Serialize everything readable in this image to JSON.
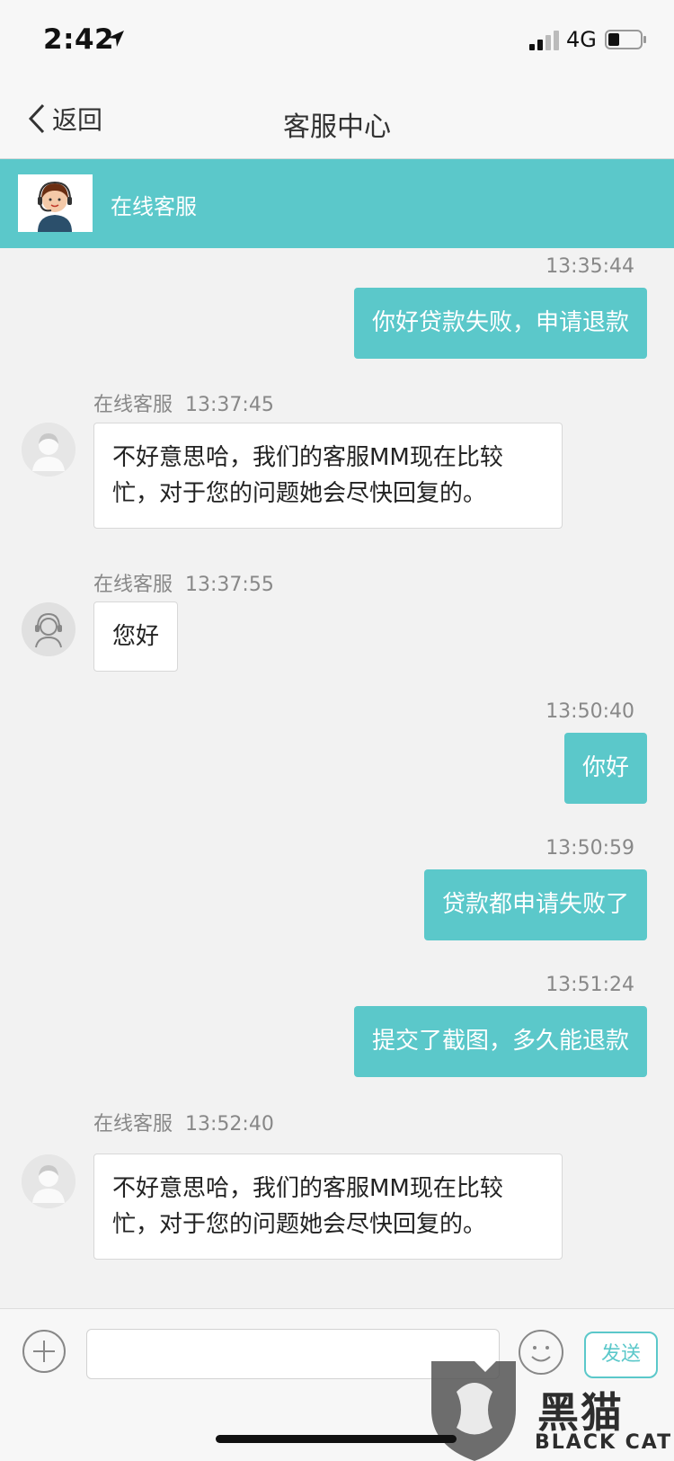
{
  "status_bar": {
    "time": "2:42",
    "network": "4G",
    "signal_bars": 2,
    "battery_level": 0.25
  },
  "nav": {
    "back_label": "返回",
    "title": "客服中心"
  },
  "agent_banner": {
    "name": "在线客服"
  },
  "messages": [
    {
      "time": "13:35:44",
      "text": "你好贷款失败，申请退款"
    },
    {
      "sender": "在线客服",
      "time": "13:37:45",
      "text": "不好意思哈，我们的客服MM现在比较忙，对于您的问题她会尽快回复的。"
    },
    {
      "sender": "在线客服",
      "time": "13:37:55",
      "text": "您好"
    },
    {
      "time": "13:50:40",
      "text": "你好"
    },
    {
      "time": "13:50:59",
      "text": "贷款都申请失败了"
    },
    {
      "time": "13:51:24",
      "text": "提交了截图，多久能退款"
    },
    {
      "sender": "在线客服",
      "time": "13:52:40",
      "text": "不好意思哈，我们的客服MM现在比较忙，对于您的问题她会尽快回复的。"
    }
  ],
  "input": {
    "placeholder": "",
    "send_label": "发送"
  },
  "watermark": {
    "text": "黑猫",
    "sub": "BLACK CAT"
  },
  "colors": {
    "accent": "#5bc8ca",
    "background": "#f2f2f2"
  }
}
